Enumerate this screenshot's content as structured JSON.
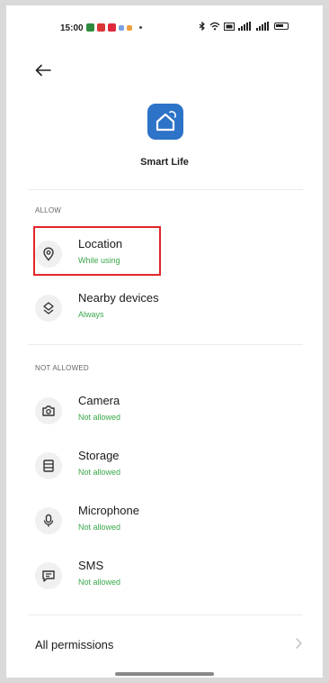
{
  "status_bar": {
    "time": "15:00",
    "notification_colors": [
      "#2e8b3e",
      "#d93636",
      "#e0283c",
      "#7aa0e0",
      "#f0a040"
    ],
    "signal_text_1": "ᵀᴵ",
    "signal_text_2": "ᵀᴵ"
  },
  "app": {
    "name": "Smart Life",
    "icon": "house-icon",
    "icon_color": "#2d73c8"
  },
  "sections": {
    "allow_label": "ALLOW",
    "not_allowed_label": "NOT ALLOWED"
  },
  "permissions_allowed": [
    {
      "title": "Location",
      "status": "While using",
      "icon": "location-pin-icon"
    },
    {
      "title": "Nearby devices",
      "status": "Always",
      "icon": "nearby-devices-icon"
    }
  ],
  "permissions_denied": [
    {
      "title": "Camera",
      "status": "Not allowed",
      "icon": "camera-icon"
    },
    {
      "title": "Storage",
      "status": "Not allowed",
      "icon": "storage-icon"
    },
    {
      "title": "Microphone",
      "status": "Not allowed",
      "icon": "microphone-icon"
    },
    {
      "title": "SMS",
      "status": "Not allowed",
      "icon": "sms-icon"
    }
  ],
  "all_permissions_label": "All permissions",
  "colors": {
    "status_green": "#3aa84a",
    "highlight_red": "#e0262a"
  }
}
